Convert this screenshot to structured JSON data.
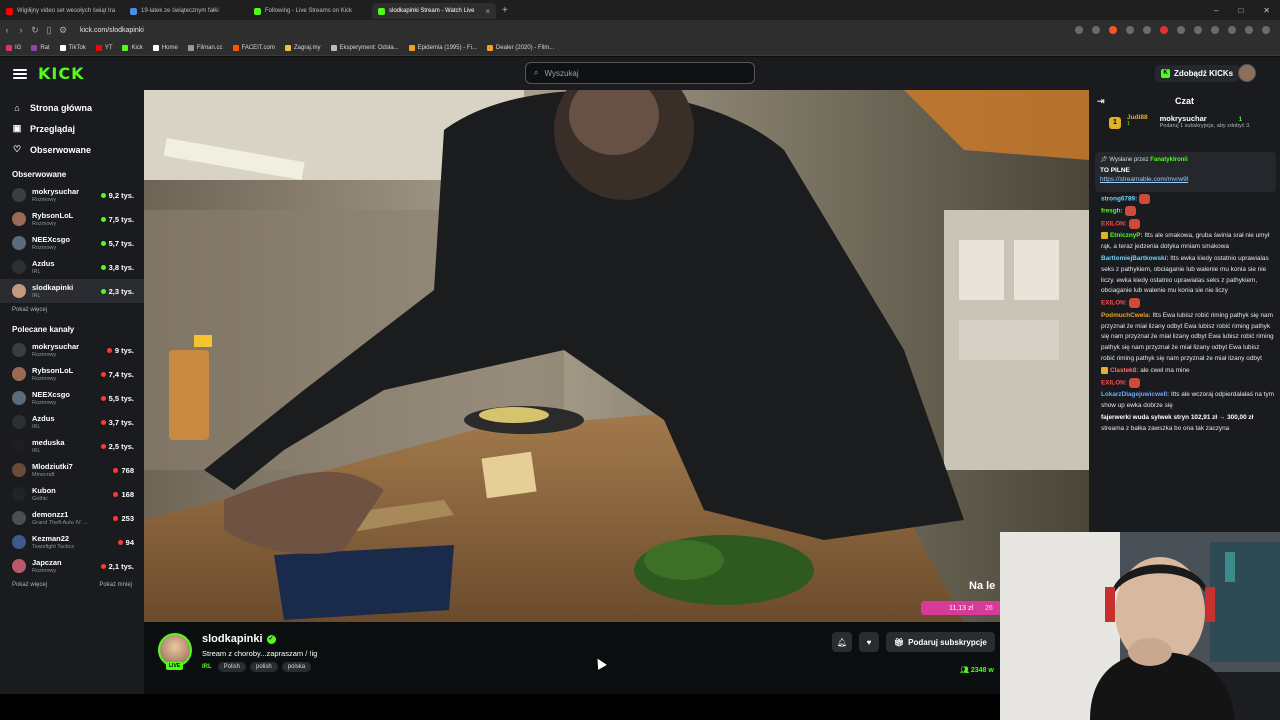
{
  "browser": {
    "tabs": [
      {
        "title": "Wigilijny video set wesołych świąt Ira",
        "color": "#ff0000",
        "active": false
      },
      {
        "title": "19-latek ze świątecznym fałki",
        "color": "#4a90e2",
        "active": false
      },
      {
        "title": "Following - Live Streams on Kick",
        "color": "#53fc18",
        "active": false
      },
      {
        "title": "slodkapinki Stream - Watch Live",
        "color": "#53fc18",
        "active": true
      }
    ],
    "new_tab": "+",
    "url": "kick.com/slodkapinki",
    "bookmarks": [
      {
        "label": "IG",
        "color": "#e1306c"
      },
      {
        "label": "Rat",
        "color": "#8e44ad"
      },
      {
        "label": "TikTok",
        "color": "#ffffff"
      },
      {
        "label": "YT",
        "color": "#ff0000"
      },
      {
        "label": "Kick",
        "color": "#53fc18"
      },
      {
        "label": "Home",
        "color": "#ffffff"
      },
      {
        "label": "Filman.cc",
        "color": "#999999"
      },
      {
        "label": "FACEIT.com",
        "color": "#ff5500"
      },
      {
        "label": "Zagraj.my",
        "color": "#f0c040"
      },
      {
        "label": "Eksperyment: Odsła...",
        "color": "#bbbbbb"
      },
      {
        "label": "Epidemia (1995) - Fi...",
        "color": "#f0a020"
      },
      {
        "label": "Dealer (2020) - Film...",
        "color": "#f0a020"
      }
    ]
  },
  "header": {
    "logo": "KICK",
    "search_placeholder": "Wyszukaj",
    "kicks_button": "Zdobądź KICKs"
  },
  "sidebar": {
    "nav": [
      {
        "icon": "home-icon",
        "label": "Strona główna"
      },
      {
        "icon": "browse-icon",
        "label": "Przeglądaj"
      },
      {
        "icon": "heart-icon",
        "label": "Obserwowane"
      }
    ],
    "followed_title": "Obserwowane",
    "followed": [
      {
        "name": "mokrysuchar",
        "category": "Rozmowy",
        "viewers": "9,2 tys.",
        "color": "#3a3d44"
      },
      {
        "name": "RybsonLoL",
        "category": "Rozmowy",
        "viewers": "7,5 tys.",
        "color": "#9b6a55"
      },
      {
        "name": "NEEXcsgo",
        "category": "Rozmowy",
        "viewers": "5,7 tys.",
        "color": "#5a6b7a"
      },
      {
        "name": "Azdus",
        "category": "IRL",
        "viewers": "3,8 tys.",
        "color": "#2d2f35"
      },
      {
        "name": "slodkapinki",
        "category": "IRL",
        "viewers": "2,3 tys.",
        "color": "#c29a82"
      }
    ],
    "show_more": "Pokaż więcej",
    "recommended_title": "Polecane kanały",
    "recommended": [
      {
        "name": "mokrysuchar",
        "category": "Rozmowy",
        "viewers": "9 tys.",
        "color": "#3a3d44"
      },
      {
        "name": "RybsonLoL",
        "category": "Rozmowy",
        "viewers": "7,4 tys.",
        "color": "#9b6a55"
      },
      {
        "name": "NEEXcsgo",
        "category": "Rozmowy",
        "viewers": "5,5 tys.",
        "color": "#5a6b7a"
      },
      {
        "name": "Azdus",
        "category": "IRL",
        "viewers": "3,7 tys.",
        "color": "#2d2f35"
      },
      {
        "name": "meduska",
        "category": "IRL",
        "viewers": "2,5 tys.",
        "color": "#1e1e1e"
      },
      {
        "name": "Mlodziutki7",
        "category": "Minecraft",
        "viewers": "768",
        "color": "#6a4a3a"
      },
      {
        "name": "Kubon",
        "category": "Gothic",
        "viewers": "168",
        "color": "#20242a"
      },
      {
        "name": "demonzz1",
        "category": "Grand Theft Auto IV: ...",
        "viewers": "253",
        "color": "#4a4f55"
      },
      {
        "name": "Kezman22",
        "category": "Teamfight Tactics",
        "viewers": "94",
        "color": "#3b5c8a"
      },
      {
        "name": "Japczan",
        "category": "Rozmowy",
        "viewers": "2,1 tys.",
        "color": "#b85a6a"
      }
    ],
    "show_more_2": "Pokaż więcej",
    "show_less": "Pokaż mniej"
  },
  "stream": {
    "overlay_text": "Na le",
    "overlay_amount": "11,13 zł",
    "overlay_amount2": "26",
    "streamer": "slodkapinki",
    "live": "LIVE",
    "title": "Stream z choroby...zapraszam / !ig",
    "category": "IRL",
    "tags": [
      "Polish",
      "polish",
      "polska"
    ],
    "subscribe": "Podaruj subskrypcje",
    "viewers": "2348 w"
  },
  "chat": {
    "title": "Czat",
    "gifter_rank": "1",
    "gifter_user": "Judi88",
    "gifter_count": "1",
    "top_user": "mokrysuchar",
    "top_count": "1",
    "top_desc": "Podaruj 1 subskrypcje, aby zdobyć 3.",
    "pinned_by": "Wysłane przez",
    "pinned_user": "FanatykIronii",
    "pinned_title": "TO PILNE",
    "pinned_link": "https://streamable.com/mvrw9l",
    "messages": [
      {
        "user": "strong6789:",
        "color": "#6fd3ff",
        "text": "",
        "emote": true
      },
      {
        "user": "fresgh:",
        "color": "#53fc18",
        "text": "",
        "emote": true
      },
      {
        "user": "EXILON:",
        "color": "#ff4a4a",
        "text": "",
        "emote": true
      },
      {
        "user": "EtnicznyP:",
        "color": "#53fc18",
        "text": "Itts ale smakowa, gruba świnia srał nie umył rąk, a teraz jedzenia dotyka mniam smakowa",
        "badge": true
      },
      {
        "user": "BartlomiejBartkowski:",
        "color": "#6fd3ff",
        "text": "Itts ewka kiedy ostatnio uprawialas seks z pathykiem, obciaganie lub walenie mu konia sie nie liczy. ewka kiedy ostatnio uprawialas seks z pathykiem, obciaganie lub walenie mu konia sie nie liczy"
      },
      {
        "user": "EXILON:",
        "color": "#ff4a4a",
        "text": "",
        "emote": true
      },
      {
        "user": "PodmuchCwela:",
        "color": "#f0a020",
        "text": "Itts Ewa lubisz robić riming pathyk się nam przyznał że miał lizany odbyt Ewa lubisz robić riming pathyk się nam przyznał że miał lizany odbyt Ewa lubisz robić riming pathyk się nam przyznał że miał lizany odbyt Ewa lubisz robić riming pathyk się nam przyznał że miał lizany odbyt"
      },
      {
        "user": "Clastek8:",
        "color": "#ff6b6b",
        "text": "ale cwel ma mine",
        "badge": true
      },
      {
        "user": "EXILON:",
        "color": "#ff4a4a",
        "text": "",
        "emote": true
      },
      {
        "user": "LokarzDlagejuwicwell:",
        "color": "#6fa8ff",
        "text": "Itts ale wczoraj odpierdalałaś na tym show up ewka dobrze się"
      },
      {
        "user": "fajerwerki wuda sylwek stryn 102,91 zł → 300,00 zł",
        "color": "#ffffff",
        "text": ""
      },
      {
        "user": "",
        "color": "#ffffff",
        "text": "streama z bałka zawszka bo ona tak zaczyna"
      }
    ]
  },
  "colors": {
    "accent": "#53fc18",
    "bg": "#0b0e0f",
    "panel": "#191b1f"
  }
}
